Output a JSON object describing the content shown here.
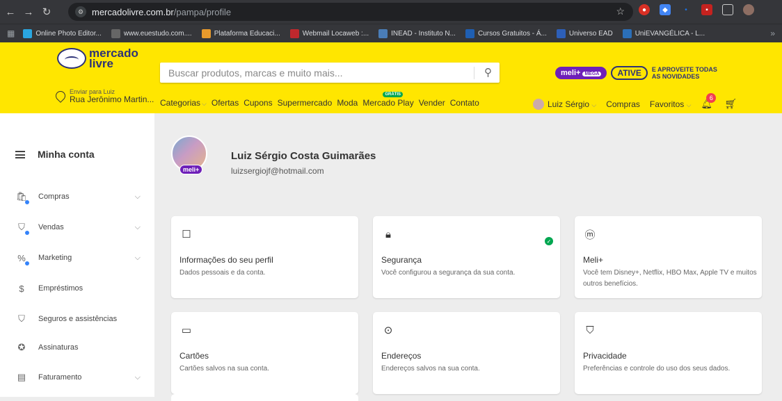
{
  "browser": {
    "url_host": "mercadolivre.com.br",
    "url_path": "/pampa/profile",
    "bookmarks": [
      {
        "label": "Online Photo Editor...",
        "color": "#2aa6e0"
      },
      {
        "label": "www.euestudo.com....",
        "color": "#666666"
      },
      {
        "label": "Plataforma Educaci...",
        "color": "#e89a2c"
      },
      {
        "label": "Webmail Locaweb :...",
        "color": "#c0282d"
      },
      {
        "label": "INEAD - Instituto N...",
        "color": "#4a7db8"
      },
      {
        "label": "Cursos Gratuitos - Á...",
        "color": "#1f5fb3"
      },
      {
        "label": "Universo EAD",
        "color": "#2d5fb8"
      },
      {
        "label": "UniEVANGÉLICA - L...",
        "color": "#2b6fb8"
      }
    ]
  },
  "header": {
    "logo_line1": "mercado",
    "logo_line2": "livre",
    "search_placeholder": "Buscar produtos, marcas e muito mais...",
    "promo": {
      "meli": "meli+",
      "mega": "MEGA",
      "ative": "ATIVE",
      "text1": "E APROVEITE TODAS",
      "text2": "AS NOVIDADES"
    },
    "location_label": "Enviar para Luiz",
    "location_address": "Rua Jerônimo Martin...",
    "nav": [
      "Categorias",
      "Ofertas",
      "Cupons",
      "Supermercado",
      "Moda",
      "Mercado Play",
      "Vender",
      "Contato"
    ],
    "gratis_badge": "GRÁTIS",
    "user_name": "Luiz Sérgio",
    "compras": "Compras",
    "favoritos": "Favoritos",
    "notifications": "6"
  },
  "sidebar": {
    "title": "Minha conta",
    "items": [
      {
        "label": "Compras",
        "icon": "bag-icon",
        "expandable": true
      },
      {
        "label": "Vendas",
        "icon": "tag-icon",
        "expandable": true
      },
      {
        "label": "Marketing",
        "icon": "percent-icon",
        "expandable": true
      },
      {
        "label": "Empréstimos",
        "icon": "money-hand-icon",
        "expandable": false
      },
      {
        "label": "Seguros e assistências",
        "icon": "shield-icon",
        "expandable": false
      },
      {
        "label": "Assinaturas",
        "icon": "star-badge-icon",
        "expandable": false
      },
      {
        "label": "Faturamento",
        "icon": "invoice-icon",
        "expandable": true
      }
    ]
  },
  "profile": {
    "name": "Luiz Sérgio Costa Guimarães",
    "email": "luizsergiojf@hotmail.com",
    "badge": "meli+"
  },
  "cards": [
    {
      "title": "Informações do seu perfil",
      "desc": "Dados pessoais e da conta.",
      "icon": "id-badge-icon",
      "check": false
    },
    {
      "title": "Segurança",
      "desc": "Você configurou a segurança da sua conta.",
      "icon": "lock-icon",
      "check": true
    },
    {
      "title": "Meli+",
      "desc": "Você tem Disney+, Netflix, HBO Max, Apple TV e muitos outros benefícios.",
      "icon": "meli-plus-icon",
      "check": false
    },
    {
      "title": "Cartões",
      "desc": "Cartões salvos na sua conta.",
      "icon": "card-icon",
      "check": false
    },
    {
      "title": "Endereços",
      "desc": "Endereços salvos na sua conta.",
      "icon": "location-pin-icon",
      "check": false
    },
    {
      "title": "Privacidade",
      "desc": "Preferências e controle do uso dos seus dados.",
      "icon": "privacy-shield-icon",
      "check": false
    }
  ],
  "colors": {
    "brand_yellow": "#ffe600",
    "brand_blue": "#2d3277",
    "meli_purple": "#6e1fb8",
    "success": "#00a650"
  }
}
